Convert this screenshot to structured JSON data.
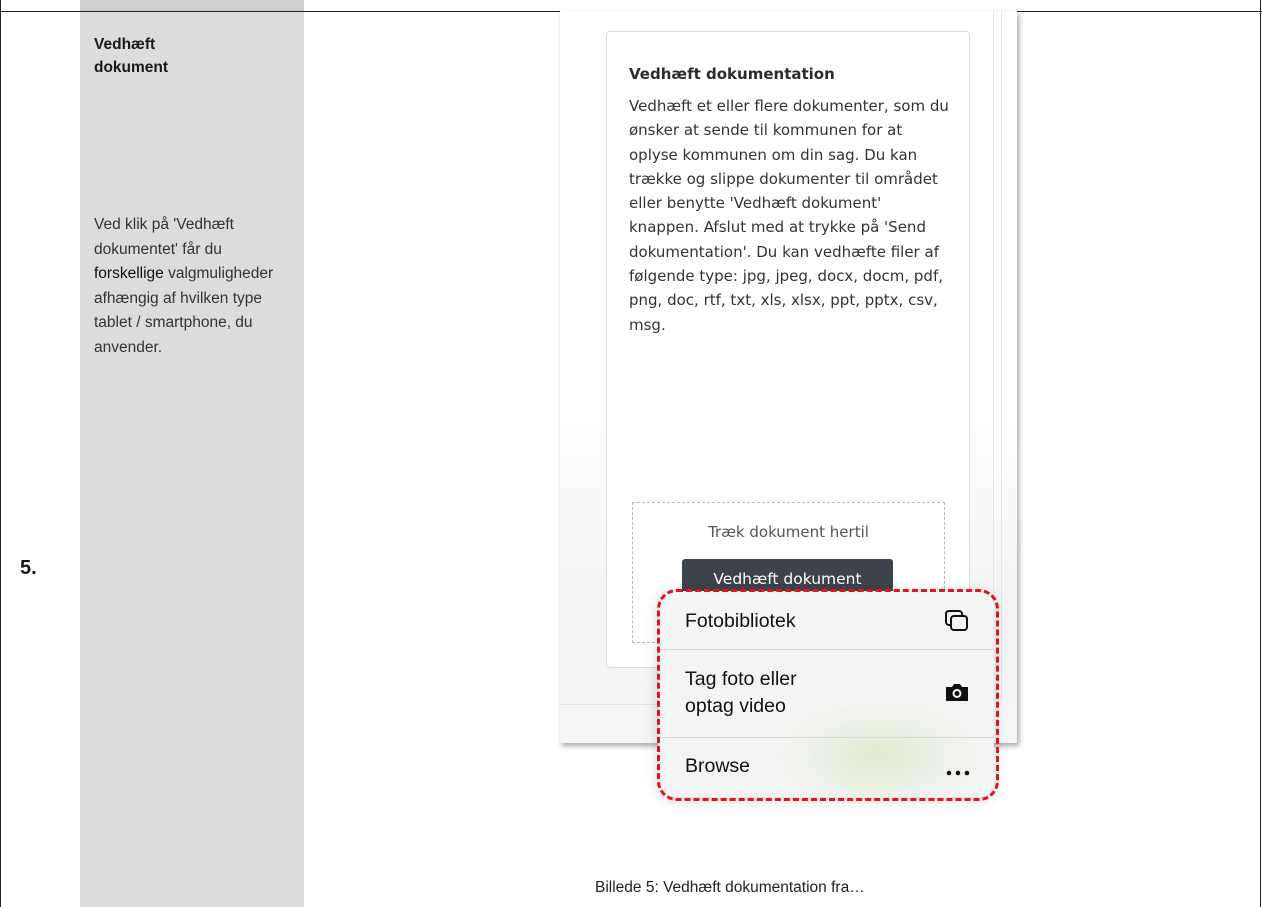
{
  "step": {
    "number": "5.",
    "title": "Vedhæft dokument",
    "description_parts": [
      "Ved klik på 'Vedhæft dokumentet' får du ",
      "forskellige",
      " valgmuligheder afhængig af hvilken type tablet / smartphone, du anvender."
    ]
  },
  "card": {
    "title": "Vedhæft dokumentation",
    "body": "Vedhæft et eller flere dokumenter, som du ønsker at sende til kommunen for at oplyse kommunen om din sag. Du kan trække og slippe dokumenter til området eller benytte 'Vedhæft dokument' knappen. Afslut med at trykke på 'Send dokumentation'. Du kan vedhæfte filer af følgende type: jpg, jpeg, docx, docm, pdf, png, doc, rtf, txt, xls, xlsx, ppt, pptx, csv, msg.",
    "dropzone_text": "Træk dokument hertil",
    "attach_button": "Vedhæft dokument"
  },
  "menu": {
    "items": [
      {
        "label": "Fotobibliotek",
        "icon": "photo-library-icon"
      },
      {
        "label_line1": "Tag foto eller",
        "label_line2": "optag video",
        "icon": "camera-icon"
      },
      {
        "label": "Browse",
        "icon": "ellipsis-icon"
      }
    ],
    "highlight_color": "#e0141e"
  },
  "caption": "Billede 5: Vedhæft dokumentation fra…"
}
